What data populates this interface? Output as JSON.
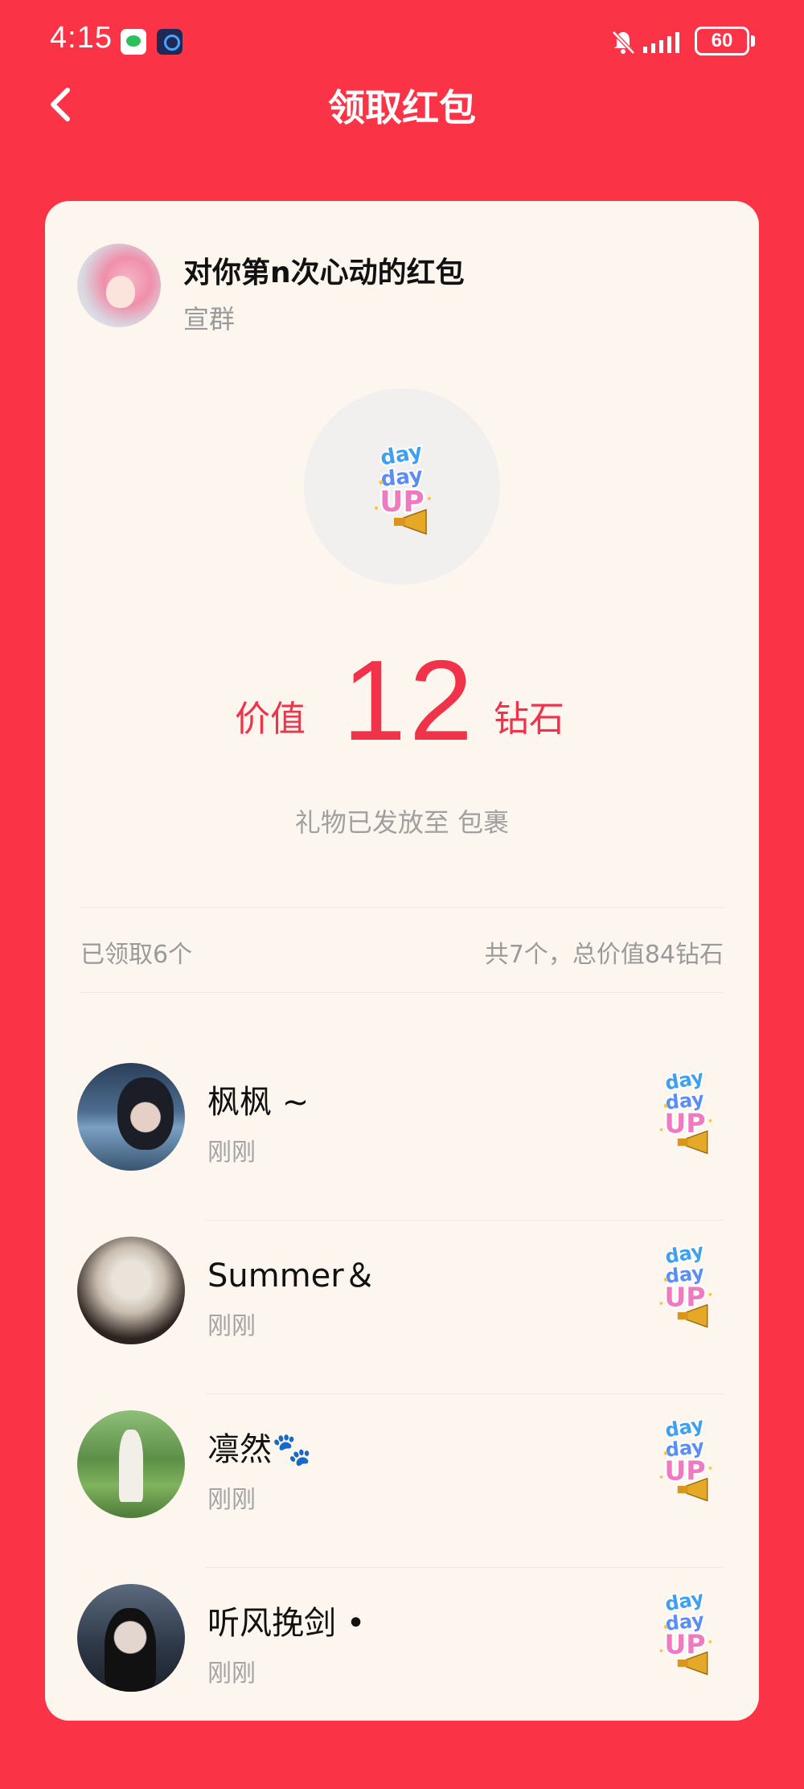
{
  "status_bar": {
    "time": "4:15",
    "battery": "60"
  },
  "header": {
    "title": "领取红包"
  },
  "packet": {
    "title": "对你第n次心动的红包",
    "sender": "宣群",
    "value_prefix": "价值",
    "value": "12",
    "value_unit": "钻石",
    "delivery_note": "礼物已发放至 包裹"
  },
  "summary": {
    "received": "已领取6个",
    "total": "共7个，总价值84钻石"
  },
  "recipients": [
    {
      "name": "枫枫 ~",
      "time": "刚刚"
    },
    {
      "name": "Summer＆",
      "time": "刚刚"
    },
    {
      "name": "凛然🐾",
      "time": "刚刚"
    },
    {
      "name": "听风挽剑 •",
      "time": "刚刚"
    }
  ],
  "colors": {
    "background": "#fb3347",
    "card": "#fdf6ee",
    "accent": "#f0334b"
  },
  "icons": {
    "gift": "day-day-up-sticker",
    "back": "chevron-left-icon"
  }
}
